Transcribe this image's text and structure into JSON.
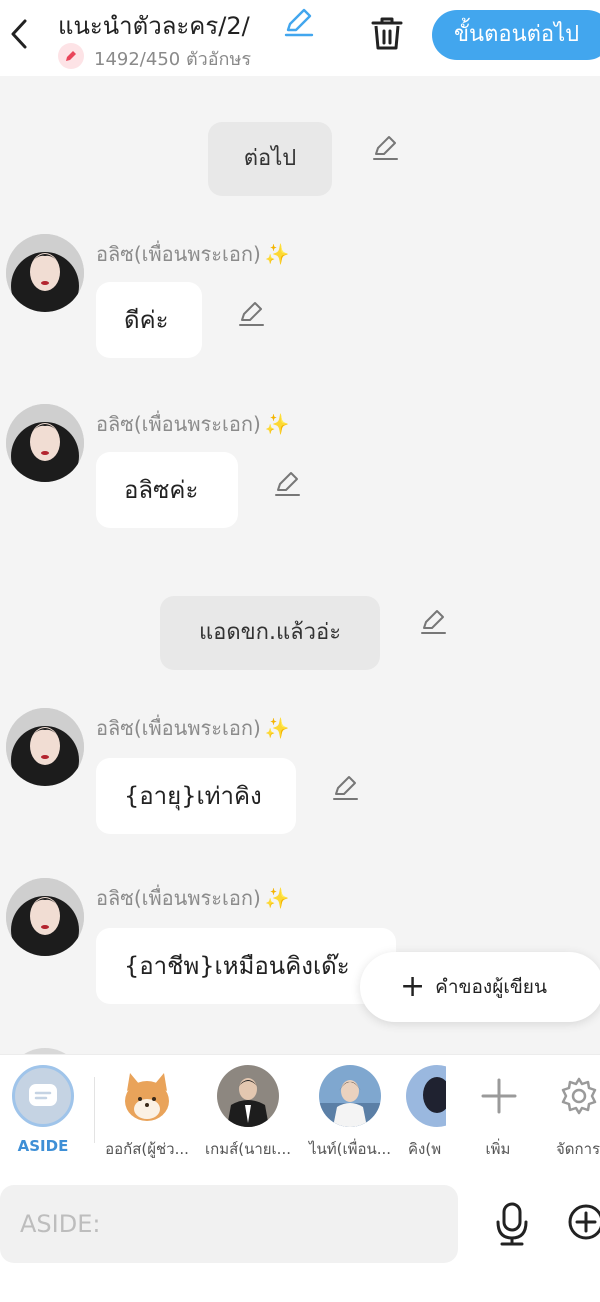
{
  "header": {
    "title": "แนะนำตัวละคร/2/",
    "char_count": "1492/450 ตัวอักษร",
    "next_label": "ขั้นตอนต่อไป"
  },
  "messages": [
    {
      "type": "narration",
      "text": "ต่อไป"
    },
    {
      "type": "speech",
      "name": "อลิซ(เพื่อนพระเอก)",
      "text": "ดีค่ะ"
    },
    {
      "type": "speech",
      "name": "อลิซ(เพื่อนพระเอก)",
      "text": "อลิซค่ะ"
    },
    {
      "type": "narration",
      "text": "แอดขก.แล้วอ่ะ"
    },
    {
      "type": "speech",
      "name": "อลิซ(เพื่อนพระเอก)",
      "text": "{อายุ}เท่าคิง"
    },
    {
      "type": "speech",
      "name": "อลิซ(เพื่อนพระเอก)",
      "text": "{อาชีพ}เหมือนคิงเด๊ะ"
    }
  ],
  "author_button": "คำของผู้เขียน",
  "characters": [
    {
      "label": "ASIDE"
    },
    {
      "label": "ออกัส(ผู้ช่ว..."
    },
    {
      "label": "เกมส์(นายเ..."
    },
    {
      "label": "ไนท์(เพื่อน..."
    },
    {
      "label": "คิง(พ"
    }
  ],
  "char_actions": {
    "add_label": "เพิ่ม",
    "manage_label": "จัดการ"
  },
  "input": {
    "placeholder": "ASIDE:"
  },
  "icons": {
    "back": "chevron-left-icon",
    "title_edit": "pencil-icon",
    "trash": "trash-icon",
    "mic": "microphone-icon",
    "plus": "plus-circle-icon",
    "settings": "gear-icon"
  },
  "colors": {
    "accent": "#42a6ee",
    "sparkle": "#f4c21a",
    "aside": "#3e8fd6"
  }
}
